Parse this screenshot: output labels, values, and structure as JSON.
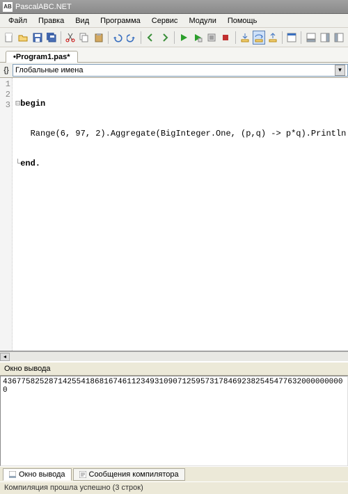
{
  "window": {
    "title": "PascalABC.NET"
  },
  "menus": [
    "Файл",
    "Правка",
    "Вид",
    "Программа",
    "Сервис",
    "Модули",
    "Помощь"
  ],
  "tabs": {
    "active": "•Program1.pas*"
  },
  "scope": {
    "label": "Глобальные имена"
  },
  "code": {
    "lines": [
      "begin",
      "   Range(6, 97, 2).Aggregate(BigInteger.One, (p,q) -> p*q).Println",
      "end."
    ]
  },
  "output": {
    "title": "Окно вывода",
    "text": "436775825287142554186816746112349310907125957317846923825454776320000000000"
  },
  "bottomTabs": {
    "output": "Окно вывода",
    "messages": "Сообщения компилятора"
  },
  "status": "Компиляция прошла успешно (3 строк)"
}
